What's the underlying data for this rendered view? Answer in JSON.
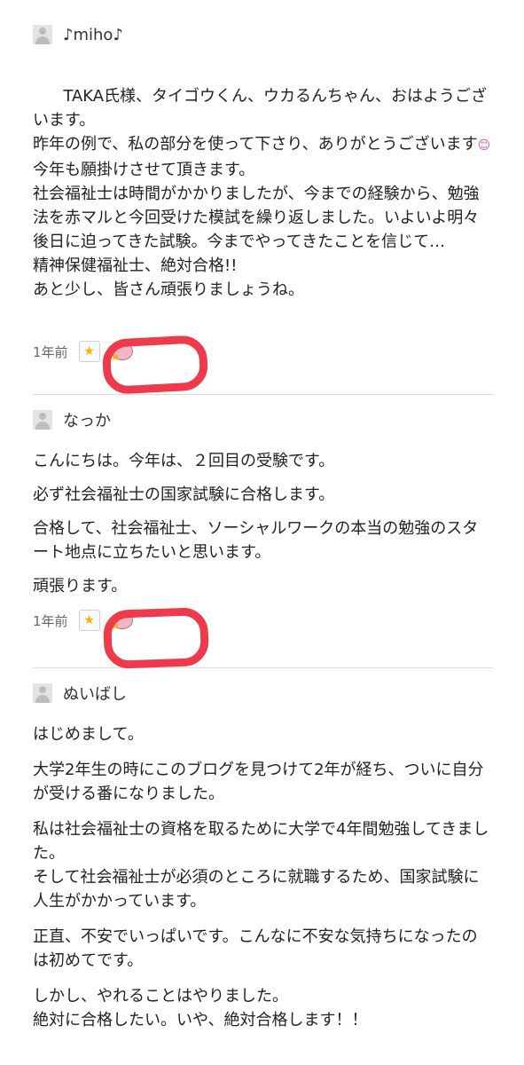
{
  "comments": [
    {
      "author": "♪miho♪",
      "paragraphs": [
        "TAKA氏様、タイゴウくん、ウカるんちゃん、おはようございます。\n昨年の例で、私の部分を使って下さり、ありがとうございます",
        "今年も願掛けさせて頂きます。\n社会福祉士は時間がかかりましたが、今までの経験から、勉強法を赤マルと今回受けた模試を繰り返しました。いよいよ明々後日に迫ってきた試験。今までやってきたことを信じて…\n精神保健福祉士、絶対合格!!\nあと少し、皆さん頑張りましょうね。"
      ],
      "emoji": "😊",
      "timestamp": "1年前"
    },
    {
      "author": "なっか",
      "paragraphs": [
        "こんにちは。今年は、２回目の受験です。",
        "必ず社会福祉士の国家試験に合格します。",
        "合格して、社会福祉士、ソーシャルワークの本当の勉強のスタート地点に立ちたいと思います。",
        "頑張ります。"
      ],
      "timestamp": "1年前"
    },
    {
      "author": "ぬいばし",
      "paragraphs": [
        "はじめまして。",
        "大学2年生の時にこのブログを見つけて2年が経ち、ついに自分が受ける番になりました。",
        "私は社会福祉士の資格を取るために大学で4年間勉強してきました。\nそして社会福祉士が必須のところに就職するため、国家試験に人生がかかっています。",
        "正直、不安でいっぱいです。こんなに不安な気持ちになったのは初めてです。",
        "しかし、やれることはやりました。\n絶対に合格したい。いや、絶対合格します！！"
      ]
    }
  ],
  "star_icon": "star-icon",
  "accent_marker_color": "#ee3a4a"
}
